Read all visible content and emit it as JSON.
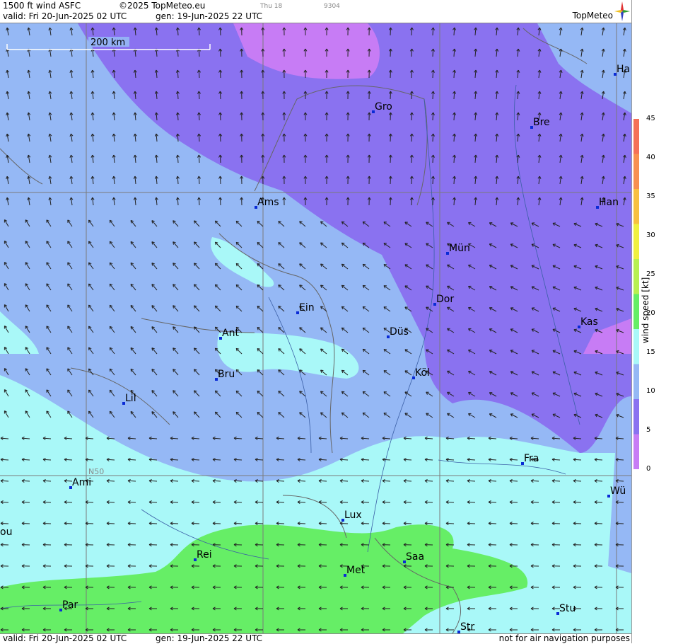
{
  "header": {
    "product": "1500 ft wind ASFC",
    "copyright": "©2025 TopMeteo.eu",
    "tab_day": "Thu 18",
    "tab_code": "9304",
    "valid": "valid:  Fri  20-Jun-2025  02 UTC",
    "gen": "gen: 19-Jun-2025 22 UTC"
  },
  "brand": {
    "name": "TopMeteo"
  },
  "map": {
    "scale_label": "200 km",
    "lat_label": "N50",
    "cities": [
      {
        "id": "ham",
        "label": "Ha"
      },
      {
        "id": "gro",
        "label": "Gro"
      },
      {
        "id": "bre",
        "label": "Bre"
      },
      {
        "id": "ams",
        "label": "Ams"
      },
      {
        "id": "han",
        "label": "Han"
      },
      {
        "id": "mun",
        "label": "Mün"
      },
      {
        "id": "ein",
        "label": "Ein"
      },
      {
        "id": "dor",
        "label": "Dor"
      },
      {
        "id": "kas",
        "label": "Kas"
      },
      {
        "id": "ant",
        "label": "Ant"
      },
      {
        "id": "dus",
        "label": "Düs"
      },
      {
        "id": "bru",
        "label": "Bru"
      },
      {
        "id": "kol",
        "label": "Köl"
      },
      {
        "id": "lil",
        "label": "Lil"
      },
      {
        "id": "fra",
        "label": "Fra"
      },
      {
        "id": "ami",
        "label": "Ami"
      },
      {
        "id": "wur",
        "label": "Wü"
      },
      {
        "id": "lux",
        "label": "Lux"
      },
      {
        "id": "rou",
        "label": "ou"
      },
      {
        "id": "rei",
        "label": "Rei"
      },
      {
        "id": "saa",
        "label": "Saa"
      },
      {
        "id": "met",
        "label": "Met"
      },
      {
        "id": "par",
        "label": "Par"
      },
      {
        "id": "stu",
        "label": "Stu"
      },
      {
        "id": "str",
        "label": "Str"
      }
    ]
  },
  "legend": {
    "unit": "wind  speed  [kt]",
    "ticks": [
      "45",
      "40",
      "35",
      "30",
      "25",
      "20",
      "15",
      "10",
      "5",
      "0"
    ],
    "colors": [
      "#c77cf5",
      "#8a72f0",
      "#95b8f5",
      "#a9f8f8",
      "#66ee66",
      "#b8f050",
      "#f0f040",
      "#f8c040",
      "#f89050",
      "#f57058"
    ]
  },
  "footer": {
    "valid": "valid:  Fri  20-Jun-2025  02 UTC",
    "gen": "gen: 19-Jun-2025 22 UTC",
    "disclaimer": "not for air navigation purposes"
  }
}
